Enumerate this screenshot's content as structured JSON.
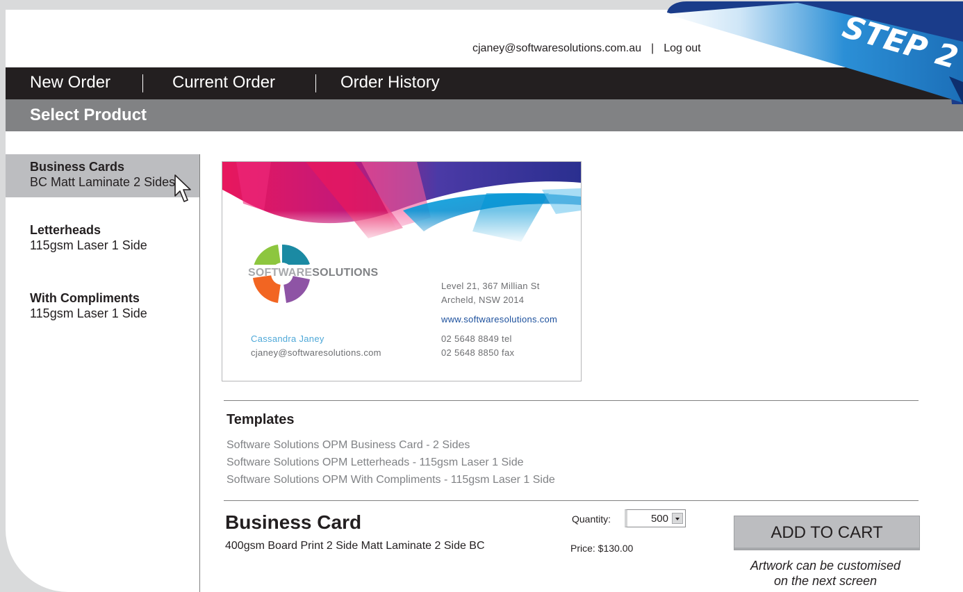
{
  "user": {
    "email": "cjaney@softwaresolutions.com.au",
    "separator": "|",
    "logout": "Log out"
  },
  "nav": {
    "items": [
      "New Order",
      "Current Order",
      "Order History"
    ]
  },
  "subheader": {
    "title": "Select Product"
  },
  "products": [
    {
      "name": "Business Cards",
      "desc": "BC Matt Laminate 2 Sides",
      "active": true
    },
    {
      "name": "Letterheads",
      "desc": "115gsm Laser 1 Side",
      "active": false
    },
    {
      "name": "With Compliments",
      "desc": "115gsm Laser 1 Side",
      "active": false
    }
  ],
  "card_preview": {
    "brand_a": "SOFTWARE",
    "brand_b": "SOLUTIONS",
    "address1": "Level 21, 367 Millian St",
    "address2": "Archeld, NSW 2014",
    "website": "www.softwaresolutions.com",
    "tel": "02 5648 8849 tel",
    "fax": "02 5648 8850 fax",
    "person_name": "Cassandra Janey",
    "person_email": "cjaney@softwaresolutions.com"
  },
  "templates": {
    "title": "Templates",
    "items": [
      "Software Solutions OPM Business Card - 2 Sides",
      "Software Solutions OPM Letterheads - 115gsm Laser 1 Side",
      "Software Solutions OPM With Compliments - 115gsm Laser 1 Side"
    ]
  },
  "product_detail": {
    "title": "Business Card",
    "desc": "400gsm Board Print 2 Side Matt Laminate 2 Side BC",
    "quantity_label": "Quantity:",
    "quantity_value": "500",
    "price": "Price: $130.00",
    "add_to_cart": "ADD TO CART",
    "note_line1": "Artwork can be customised",
    "note_line2": "on the next screen"
  },
  "ribbon": {
    "text": "STEP 2"
  },
  "colors": {
    "nav_bg": "#231f20",
    "subbar_bg": "#818284",
    "active_bg": "#bcbdc0",
    "ribbon_blue": "#1c75bc",
    "link_blue": "#1b4f9c"
  }
}
